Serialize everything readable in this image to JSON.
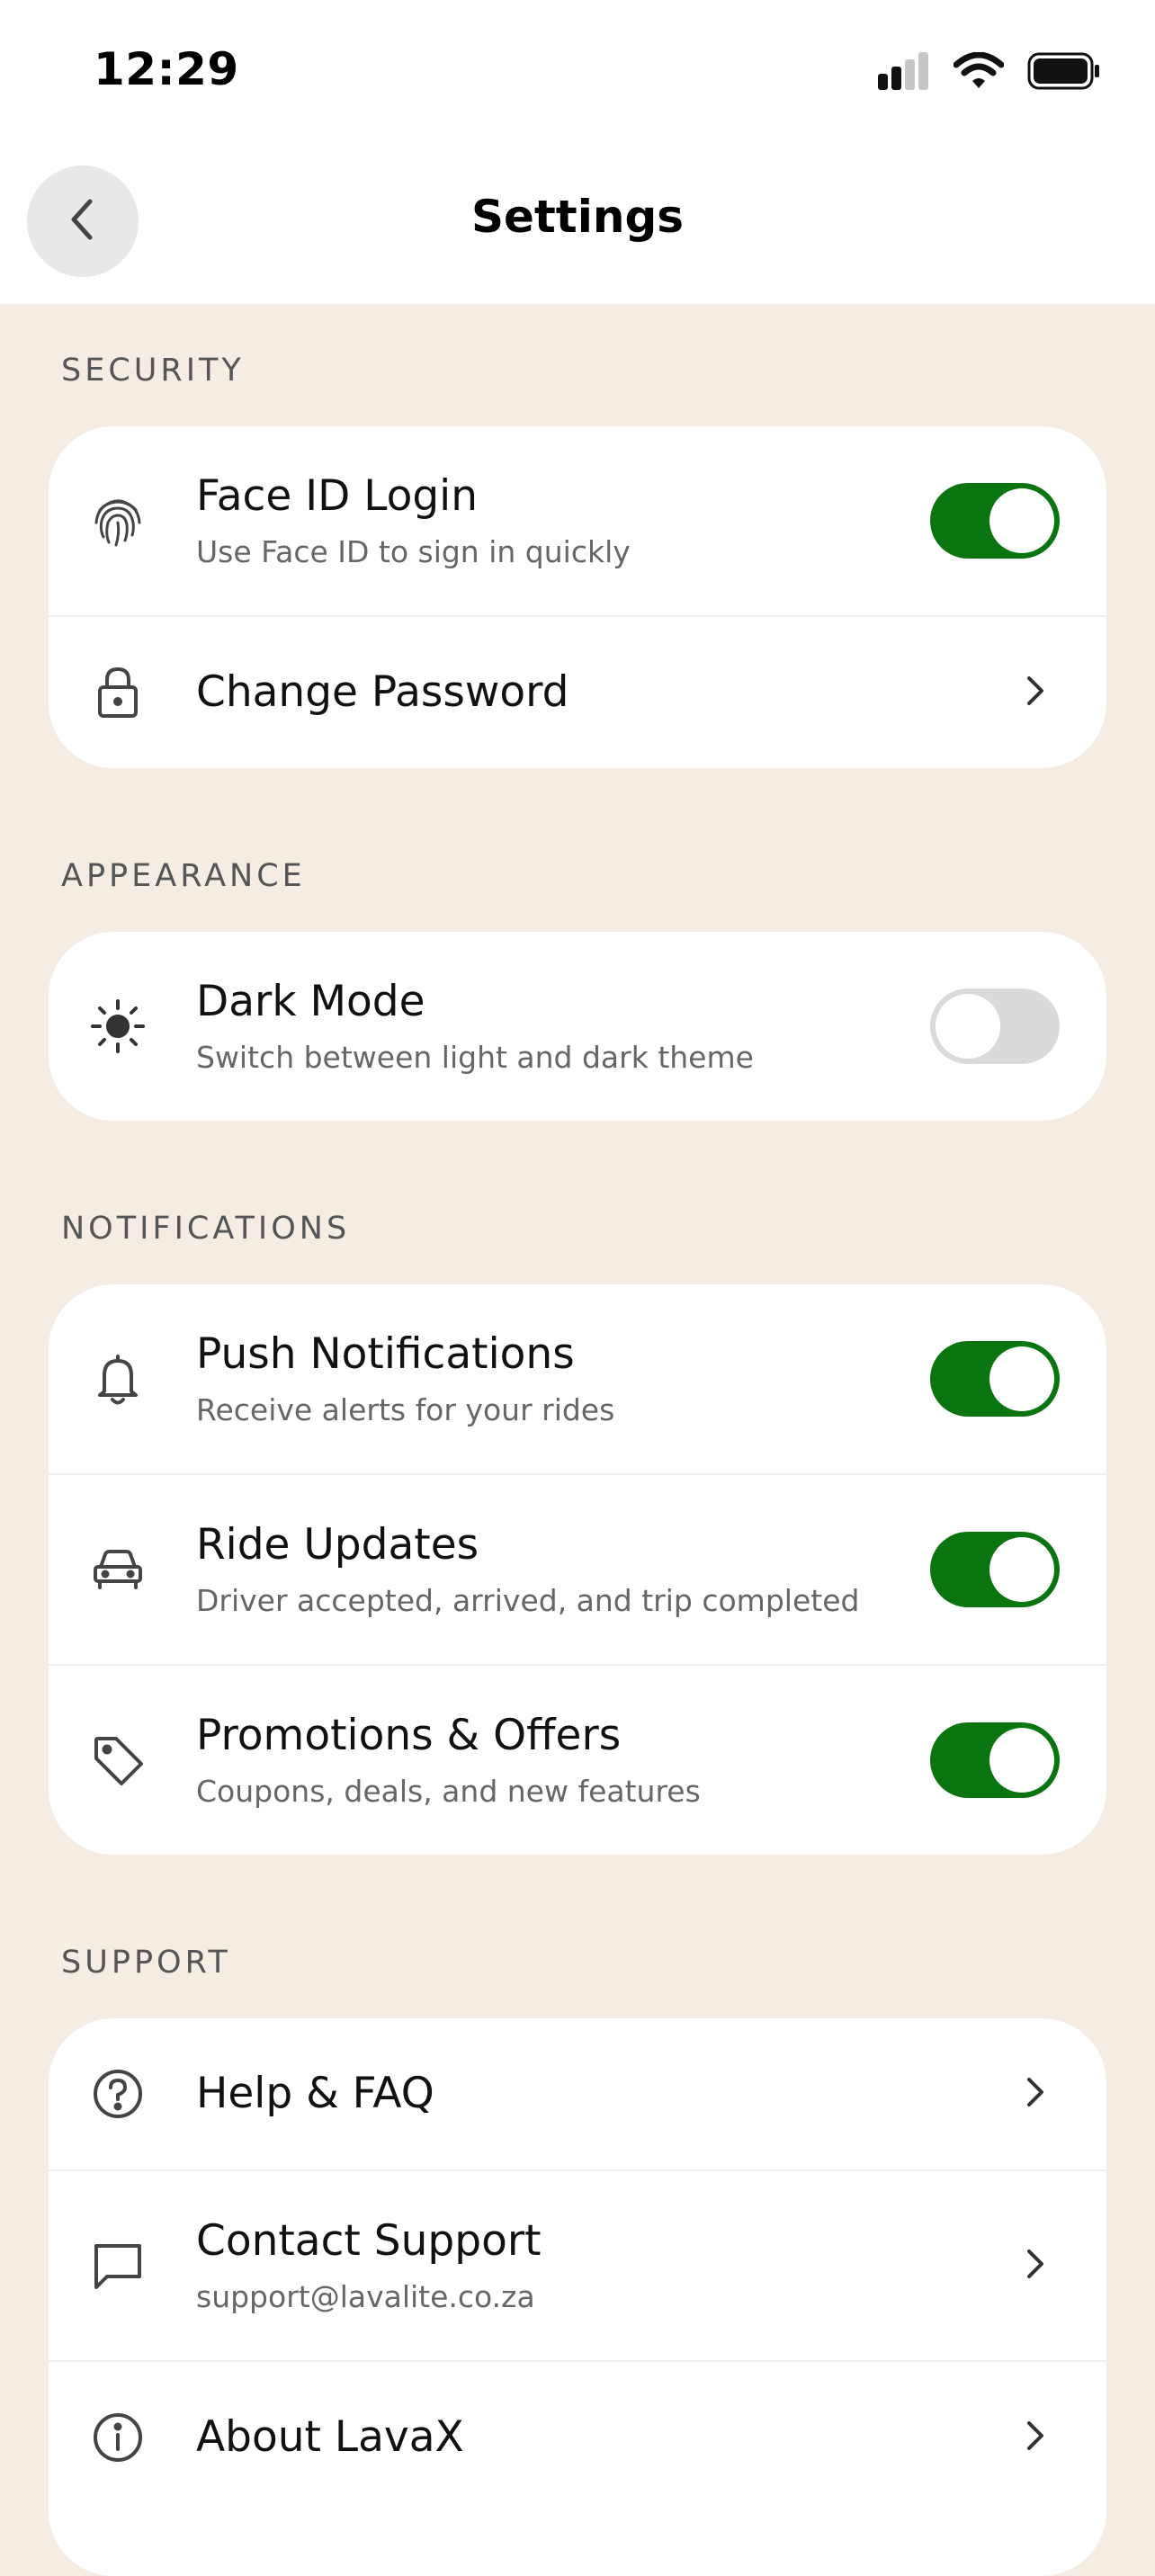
{
  "status_bar": {
    "time": "12:29",
    "battery_icon": "battery-icon",
    "wifi_icon": "wifi-icon",
    "signal_icon": "signal-icon"
  },
  "header": {
    "title": "Settings",
    "back_icon": "chevron-left-icon"
  },
  "colors": {
    "background": "#F5EDE3",
    "card": "#FFFFFF",
    "toggle_on": "#0A740E",
    "toggle_off": "#DADADA"
  },
  "sections": {
    "security": {
      "label": "SECURITY",
      "face_id": {
        "title": "Face ID Login",
        "subtitle": "Use Face ID to sign in quickly",
        "enabled": true
      },
      "change_password": {
        "title": "Change Password"
      }
    },
    "appearance": {
      "label": "APPEARANCE",
      "dark_mode": {
        "title": "Dark Mode",
        "subtitle": "Switch between light and dark theme",
        "enabled": false
      }
    },
    "notifications": {
      "label": "NOTIFICATIONS",
      "push": {
        "title": "Push Notifications",
        "subtitle": "Receive alerts for your rides",
        "enabled": true
      },
      "ride_updates": {
        "title": "Ride Updates",
        "subtitle": "Driver accepted, arrived, and trip completed",
        "enabled": true
      },
      "promotions": {
        "title": "Promotions & Offers",
        "subtitle": "Coupons, deals, and new features",
        "enabled": true
      }
    },
    "support": {
      "label": "SUPPORT",
      "help": {
        "title": "Help & FAQ"
      },
      "contact": {
        "title": "Contact Support",
        "subtitle": "support@lavalite.co.za"
      },
      "about": {
        "title": "About LavaX"
      }
    }
  }
}
